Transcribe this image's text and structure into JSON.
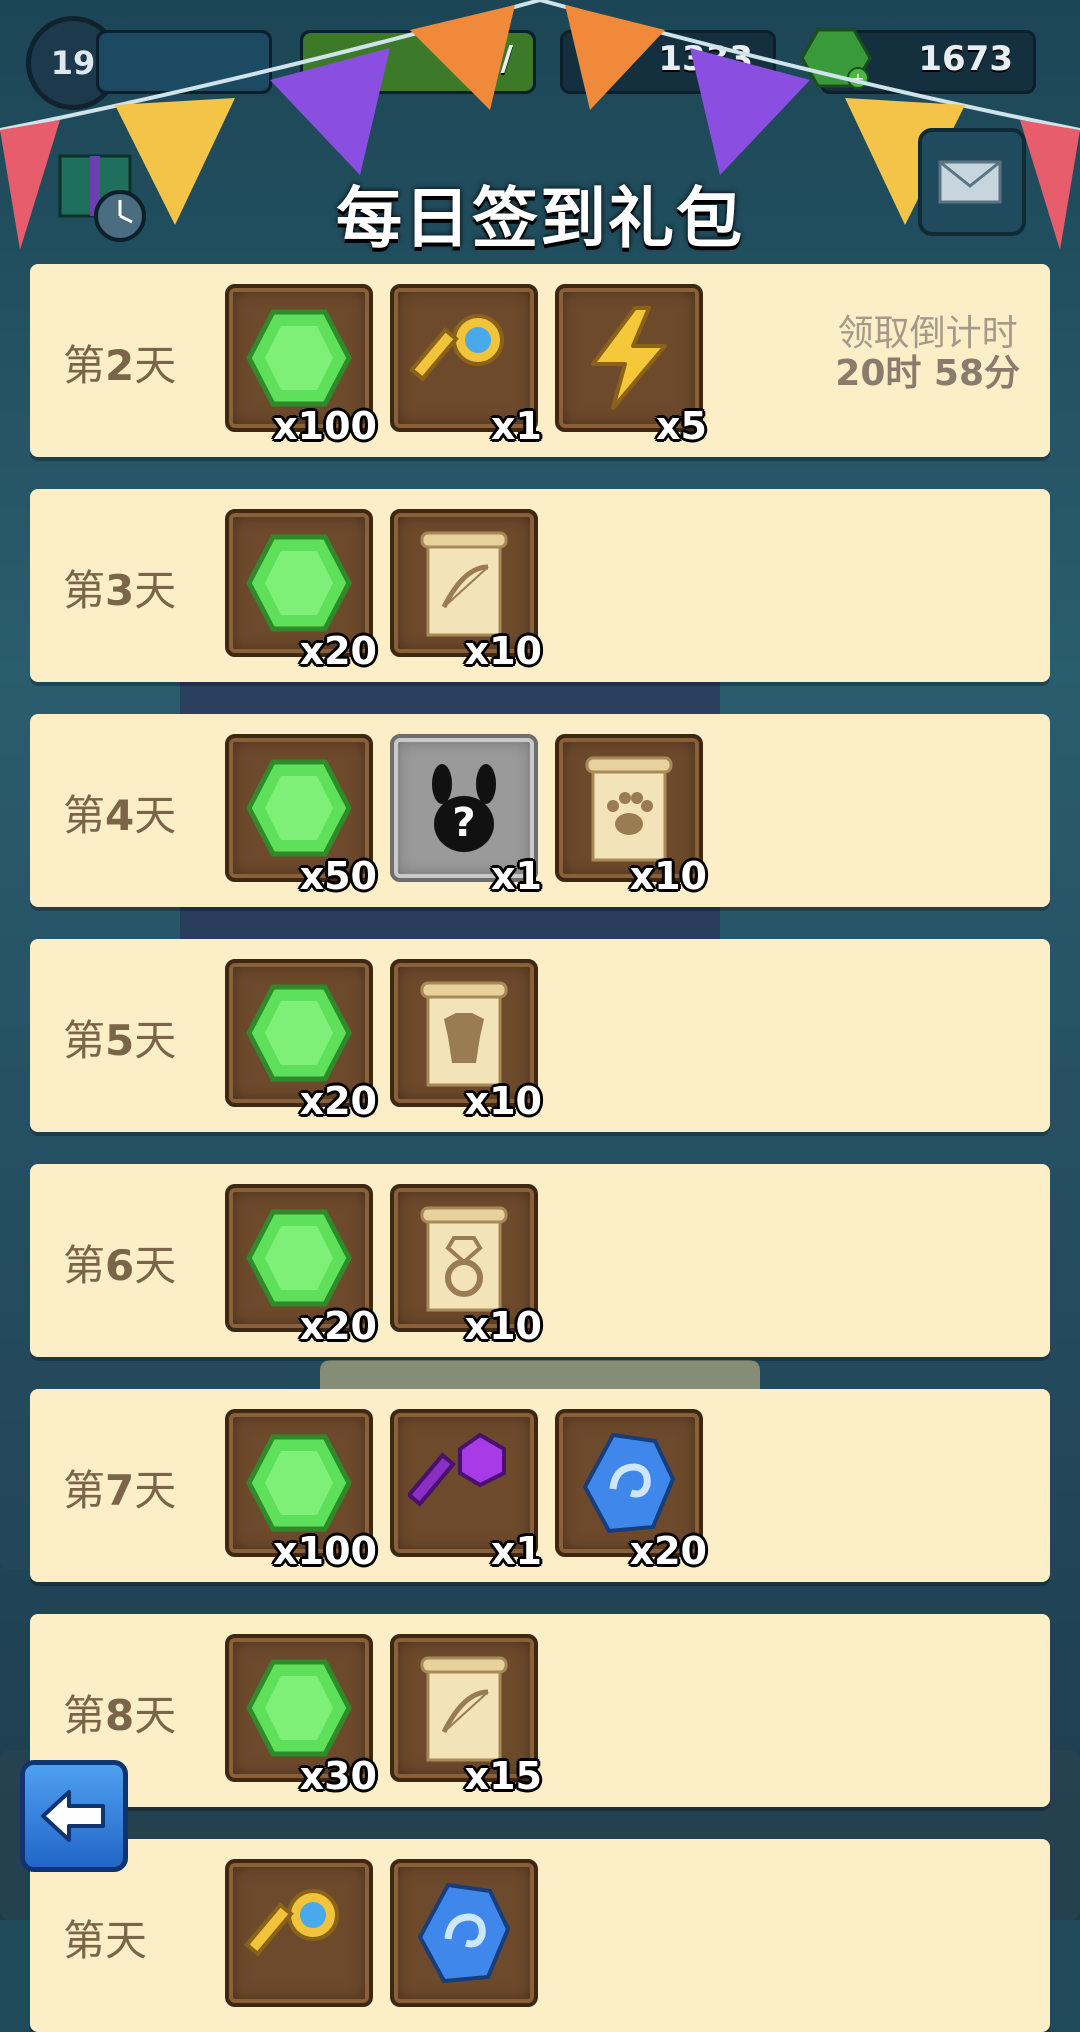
{
  "hud": {
    "level": "19",
    "energy_text": "90/",
    "coins_text": "1333",
    "gems_text": "1673"
  },
  "title": "每日签到礼包",
  "countdown": {
    "label": "领取倒计时",
    "time": "20时 58分"
  },
  "rows": [
    {
      "day_prefix": "第",
      "day_num": "2",
      "day_suffix": "天",
      "items": [
        {
          "icon": "green-gem-icon",
          "qty": "x100"
        },
        {
          "icon": "gold-key-icon",
          "qty": "x1"
        },
        {
          "icon": "lightning-icon",
          "qty": "x5"
        }
      ]
    },
    {
      "day_prefix": "第",
      "day_num": "3",
      "day_suffix": "天",
      "items": [
        {
          "icon": "green-gem-icon",
          "qty": "x20"
        },
        {
          "icon": "bow-scroll-icon",
          "qty": "x10"
        }
      ]
    },
    {
      "day_prefix": "第",
      "day_num": "4",
      "day_suffix": "天",
      "items": [
        {
          "icon": "green-gem-icon",
          "qty": "x50"
        },
        {
          "icon": "mystery-pet-icon",
          "qty": "x1"
        },
        {
          "icon": "paw-scroll-icon",
          "qty": "x10"
        }
      ]
    },
    {
      "day_prefix": "第",
      "day_num": "5",
      "day_suffix": "天",
      "items": [
        {
          "icon": "green-gem-icon",
          "qty": "x20"
        },
        {
          "icon": "armor-scroll-icon",
          "qty": "x10"
        }
      ]
    },
    {
      "day_prefix": "第",
      "day_num": "6",
      "day_suffix": "天",
      "items": [
        {
          "icon": "green-gem-icon",
          "qty": "x20"
        },
        {
          "icon": "ring-scroll-icon",
          "qty": "x10"
        }
      ]
    },
    {
      "day_prefix": "第",
      "day_num": "7",
      "day_suffix": "天",
      "items": [
        {
          "icon": "green-gem-icon",
          "qty": "x100"
        },
        {
          "icon": "purple-key-icon",
          "qty": "x1"
        },
        {
          "icon": "blue-stone-icon",
          "qty": "x20"
        }
      ]
    },
    {
      "day_prefix": "第",
      "day_num": "8",
      "day_suffix": "天",
      "items": [
        {
          "icon": "green-gem-icon",
          "qty": "x30"
        },
        {
          "icon": "bow-scroll-icon",
          "qty": "x15"
        }
      ]
    },
    {
      "day_prefix": "第",
      "day_num": "",
      "day_suffix": "天",
      "items": [
        {
          "icon": "gold-key-icon",
          "qty": ""
        },
        {
          "icon": "blue-stone-icon",
          "qty": ""
        }
      ]
    }
  ],
  "colors": {
    "row_bg": "#fcefc8",
    "day_text": "#7b6548",
    "gem": "#5fe05a",
    "item_bg": "#6e4a2c"
  }
}
